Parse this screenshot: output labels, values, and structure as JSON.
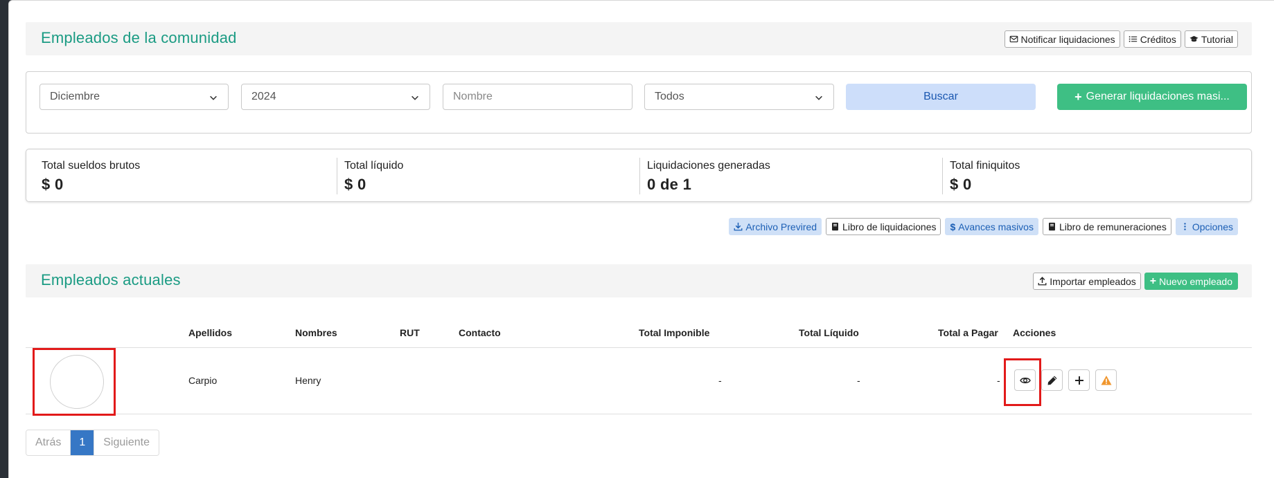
{
  "header": {
    "title": "Empleados de la comunidad",
    "buttons": {
      "notificar": "Notificar liquidaciones",
      "creditos": "Créditos",
      "tutorial": "Tutorial"
    }
  },
  "filters": {
    "month": "Diciembre",
    "year": "2024",
    "name_placeholder": "Nombre",
    "status": "Todos",
    "search_label": "Buscar",
    "generate_label": "Generar liquidaciones masi..."
  },
  "stats": [
    {
      "label": "Total sueldos brutos",
      "value": "$ 0"
    },
    {
      "label": "Total líquido",
      "value": "$ 0"
    },
    {
      "label": "Liquidaciones generadas",
      "value": "0 de 1"
    },
    {
      "label": "Total finiquitos",
      "value": "$ 0"
    }
  ],
  "actions": {
    "previred": "Archivo Previred",
    "libro_liquidaciones": "Libro de liquidaciones",
    "avances": "Avances masivos",
    "libro_remuneraciones": "Libro de remuneraciones",
    "opciones": "Opciones"
  },
  "employees_section": {
    "title": "Empleados actuales",
    "import_label": "Importar empleados",
    "new_label": "Nuevo empleado"
  },
  "table": {
    "columns": [
      "Apellidos",
      "Nombres",
      "RUT",
      "Contacto",
      "Total Imponible",
      "Total Líquido",
      "Total a Pagar",
      "Acciones"
    ],
    "rows": [
      {
        "apellidos": "Carpio",
        "nombres": "Henry",
        "rut": "",
        "contacto": "",
        "total_imponible": "-",
        "total_liquido": "-",
        "total_pagar": "-"
      }
    ]
  },
  "pagination": {
    "prev": "Atrás",
    "current": "1",
    "next": "Siguiente"
  },
  "colors": {
    "accent_green": "#3ebf84",
    "title_teal": "#1a9b83",
    "light_blue": "#cddefa",
    "highlight_red": "#e21a1a",
    "warning_orange": "#f0962e"
  }
}
